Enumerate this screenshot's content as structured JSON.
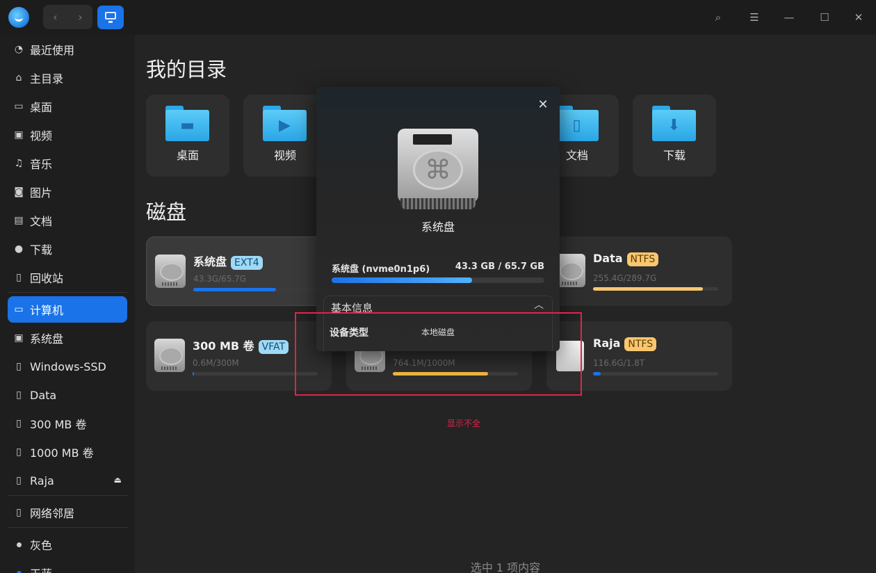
{
  "toolbar": {
    "nav_back": "‹",
    "nav_forward": "›",
    "icons": [
      "search-icon",
      "menu-icon",
      "minimize-icon",
      "maximize-icon",
      "close-icon"
    ]
  },
  "sidebar": {
    "items": [
      {
        "label": "最近使用",
        "icon": "recent-icon",
        "glyph": "◔"
      },
      {
        "label": "主目录",
        "icon": "home-icon",
        "glyph": "⌂"
      },
      {
        "label": "桌面",
        "icon": "desktop-icon",
        "glyph": "▭"
      },
      {
        "label": "视频",
        "icon": "video-icon",
        "glyph": "▣"
      },
      {
        "label": "音乐",
        "icon": "music-icon",
        "glyph": "♫"
      },
      {
        "label": "图片",
        "icon": "picture-icon",
        "glyph": "◙"
      },
      {
        "label": "文档",
        "icon": "document-icon",
        "glyph": "▤"
      },
      {
        "label": "下载",
        "icon": "download-icon",
        "glyph": "●"
      },
      {
        "label": "回收站",
        "icon": "trash-icon",
        "glyph": "▯"
      },
      {
        "label": "计算机",
        "icon": "computer-icon",
        "glyph": "▭"
      },
      {
        "label": "系统盘",
        "icon": "system-disk-icon",
        "glyph": "▣"
      },
      {
        "label": "Windows-SSD",
        "icon": "disk-icon",
        "glyph": "▯"
      },
      {
        "label": "Data",
        "icon": "disk-icon",
        "glyph": "▯"
      },
      {
        "label": "300 MB 卷",
        "icon": "disk-icon",
        "glyph": "▯"
      },
      {
        "label": "1000 MB 卷",
        "icon": "disk-icon",
        "glyph": "▯"
      },
      {
        "label": "Raja",
        "icon": "usb-disk-icon",
        "glyph": "▯",
        "eject": "⏏"
      },
      {
        "label": "网络邻居",
        "icon": "network-icon",
        "glyph": "▯"
      },
      {
        "label": "灰色",
        "icon": "tag-gray-icon",
        "color": "#d0d0d0"
      },
      {
        "label": "天蓝",
        "icon": "tag-blue-icon",
        "color": "#1a73e8"
      }
    ]
  },
  "main": {
    "my_dirs_title": "我的目录",
    "folders": [
      {
        "label": "桌面",
        "glyph": "▬"
      },
      {
        "label": "视频",
        "glyph": "▶"
      },
      {
        "label": "文档",
        "glyph": "▯"
      },
      {
        "label": "下载",
        "glyph": "⬇"
      }
    ],
    "disks_title": "磁盘",
    "disks": [
      {
        "name": "系统盘",
        "fs": "EXT4",
        "usage": "43.3G/65.7G",
        "fraction": 0.66,
        "color": "#1a73e8"
      },
      {
        "name": "Data",
        "fs": "NTFS",
        "usage": "255.4G/289.7G",
        "fraction": 0.88,
        "color": "#f9c770"
      },
      {
        "name": "300 MB 卷",
        "fs": "VFAT",
        "usage": "0.6M/300M",
        "fraction": 0.01,
        "color": "#1a73e8"
      },
      {
        "name": "",
        "fs": "",
        "usage": "764.1M/1000M",
        "fraction": 0.76,
        "color": "#f2b640"
      },
      {
        "name": "Raja",
        "fs": "NTFS",
        "usage": "116.6G/1.8T",
        "fraction": 0.06,
        "color": "#1a73e8"
      }
    ],
    "status": "选中 1 项内容"
  },
  "dialog": {
    "title": "系统盘",
    "disk_name": "系统盘 (nvme0n1p6)",
    "disk_size": "43.3 GB / 65.7 GB",
    "used_fraction": 0.66,
    "section_title": "基本信息",
    "rows": [
      {
        "key": "设备类型",
        "value": "本地磁盘"
      }
    ]
  },
  "annotation": {
    "text": "显示不全",
    "color": "#e0244a"
  }
}
